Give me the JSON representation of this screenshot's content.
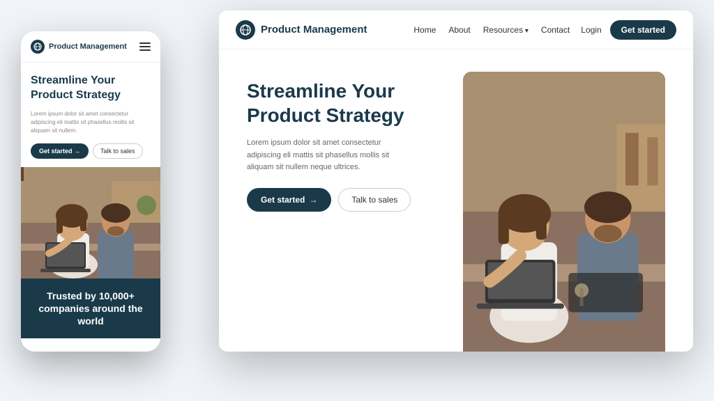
{
  "brand": {
    "name": "Product Management",
    "logo_symbol": "🌐"
  },
  "desktop": {
    "nav": {
      "links": [
        "Home",
        "About",
        "Resources",
        "Contact"
      ],
      "resources_has_dropdown": true,
      "login_label": "Login",
      "cta_label": "Get started"
    },
    "hero": {
      "title_line1": "Streamline Your",
      "title_line2": "Product Strategy",
      "description": "Lorem ipsum dolor sit amet consectetur adipiscing eli mattis sit phasellus mollis sit aliquam sit nullem neque ultrices.",
      "cta_primary": "Get started",
      "cta_secondary": "Talk to sales"
    }
  },
  "mobile": {
    "nav": {
      "logo_text": "Product Management"
    },
    "hero": {
      "title_line1": "Streamline Your",
      "title_line2": "Product Strategy",
      "description": "Lorem ipsum dolor sit amet consectetur adipiscing eli mattis sit phasellus mollis sit aliquam sit nullem.",
      "cta_primary": "Get started →",
      "cta_secondary": "Talk to sales"
    },
    "bottom": {
      "text": "Trusted by 10,000+ companies around the world"
    }
  },
  "colors": {
    "primary": "#1a3a4a",
    "text_dark": "#1a3a4a",
    "text_muted": "#666666",
    "white": "#ffffff"
  }
}
